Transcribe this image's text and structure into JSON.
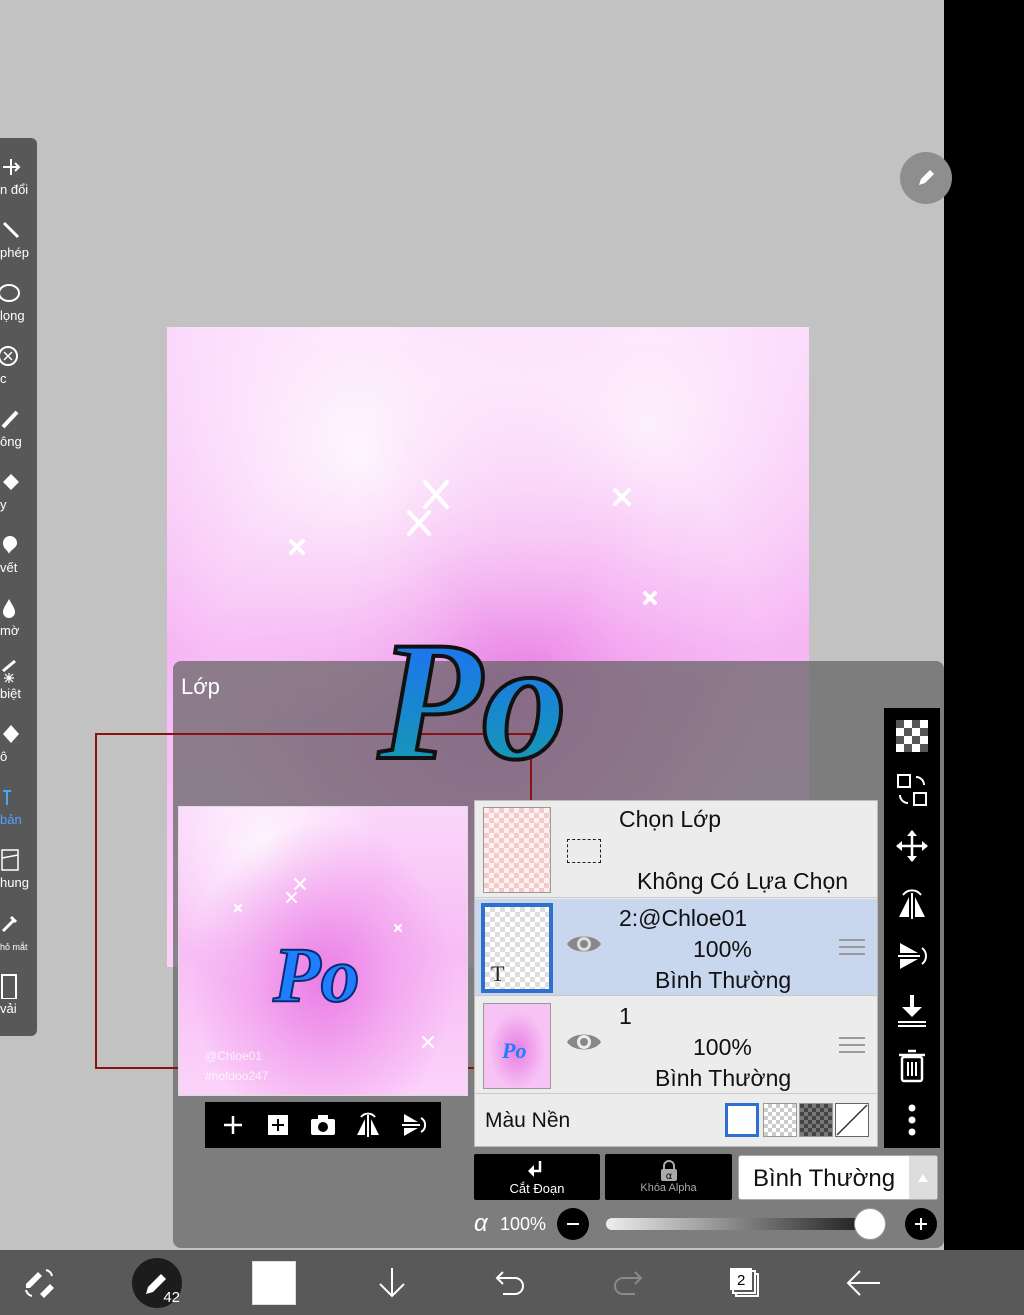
{
  "left_toolbar": {
    "items": [
      {
        "label": "n đổi",
        "icon": "transform-icon"
      },
      {
        "label": "phép",
        "icon": "magic-wand-icon"
      },
      {
        "label": "lọng",
        "icon": "lasso-icon"
      },
      {
        "label": "c",
        "icon": "filter-icon"
      },
      {
        "label": "ông",
        "icon": "brush-icon"
      },
      {
        "label": "y",
        "icon": "eraser-icon"
      },
      {
        "label": "vết",
        "icon": "smudge-icon"
      },
      {
        "label": "mờ",
        "icon": "blur-icon"
      },
      {
        "label": "biệt",
        "icon": "special-brush-icon"
      },
      {
        "label": "ô",
        "icon": "fill-icon"
      },
      {
        "label": "bản",
        "icon": "text-icon"
      },
      {
        "label": "hung",
        "icon": "frame-divider-icon"
      },
      {
        "label": "hỏ mắt",
        "icon": "eyedropper-icon"
      },
      {
        "label": "vải",
        "icon": "canvas-icon"
      }
    ]
  },
  "canvas": {
    "artwork_text": "Po",
    "colors": {
      "pink": "#f6b6f4",
      "blue": "#1e7bff",
      "teal": "#1f8ea6"
    }
  },
  "layer_panel": {
    "title": "Lớp",
    "preview": {
      "artwork_text": "Po",
      "watermark_1": "@Chloe01",
      "watermark_2": "#nofdoo247"
    },
    "selection_row": {
      "title": "Chọn Lớp",
      "status": "Không Có Lựa Chọn"
    },
    "layers": [
      {
        "name": "2:@Chloe01",
        "opacity": "100%",
        "blend": "Bình Thường",
        "type_badge": "T",
        "selected": true
      },
      {
        "name": "1",
        "opacity": "100%",
        "blend": "Bình Thường",
        "thumb_text": "Po",
        "selected": false
      }
    ],
    "background_label": "Màu Nền",
    "clip_label": "Cắt Đoạn",
    "alpha_lock_label": "Khóa Alpha",
    "blend_mode": "Bình Thường",
    "opacity_symbol": "α",
    "opacity_value": "100%",
    "opacity_fraction": 1.0
  },
  "bottom_bar": {
    "brush_size": "42",
    "layer_count": "2",
    "primary_color": "#ffffff"
  }
}
